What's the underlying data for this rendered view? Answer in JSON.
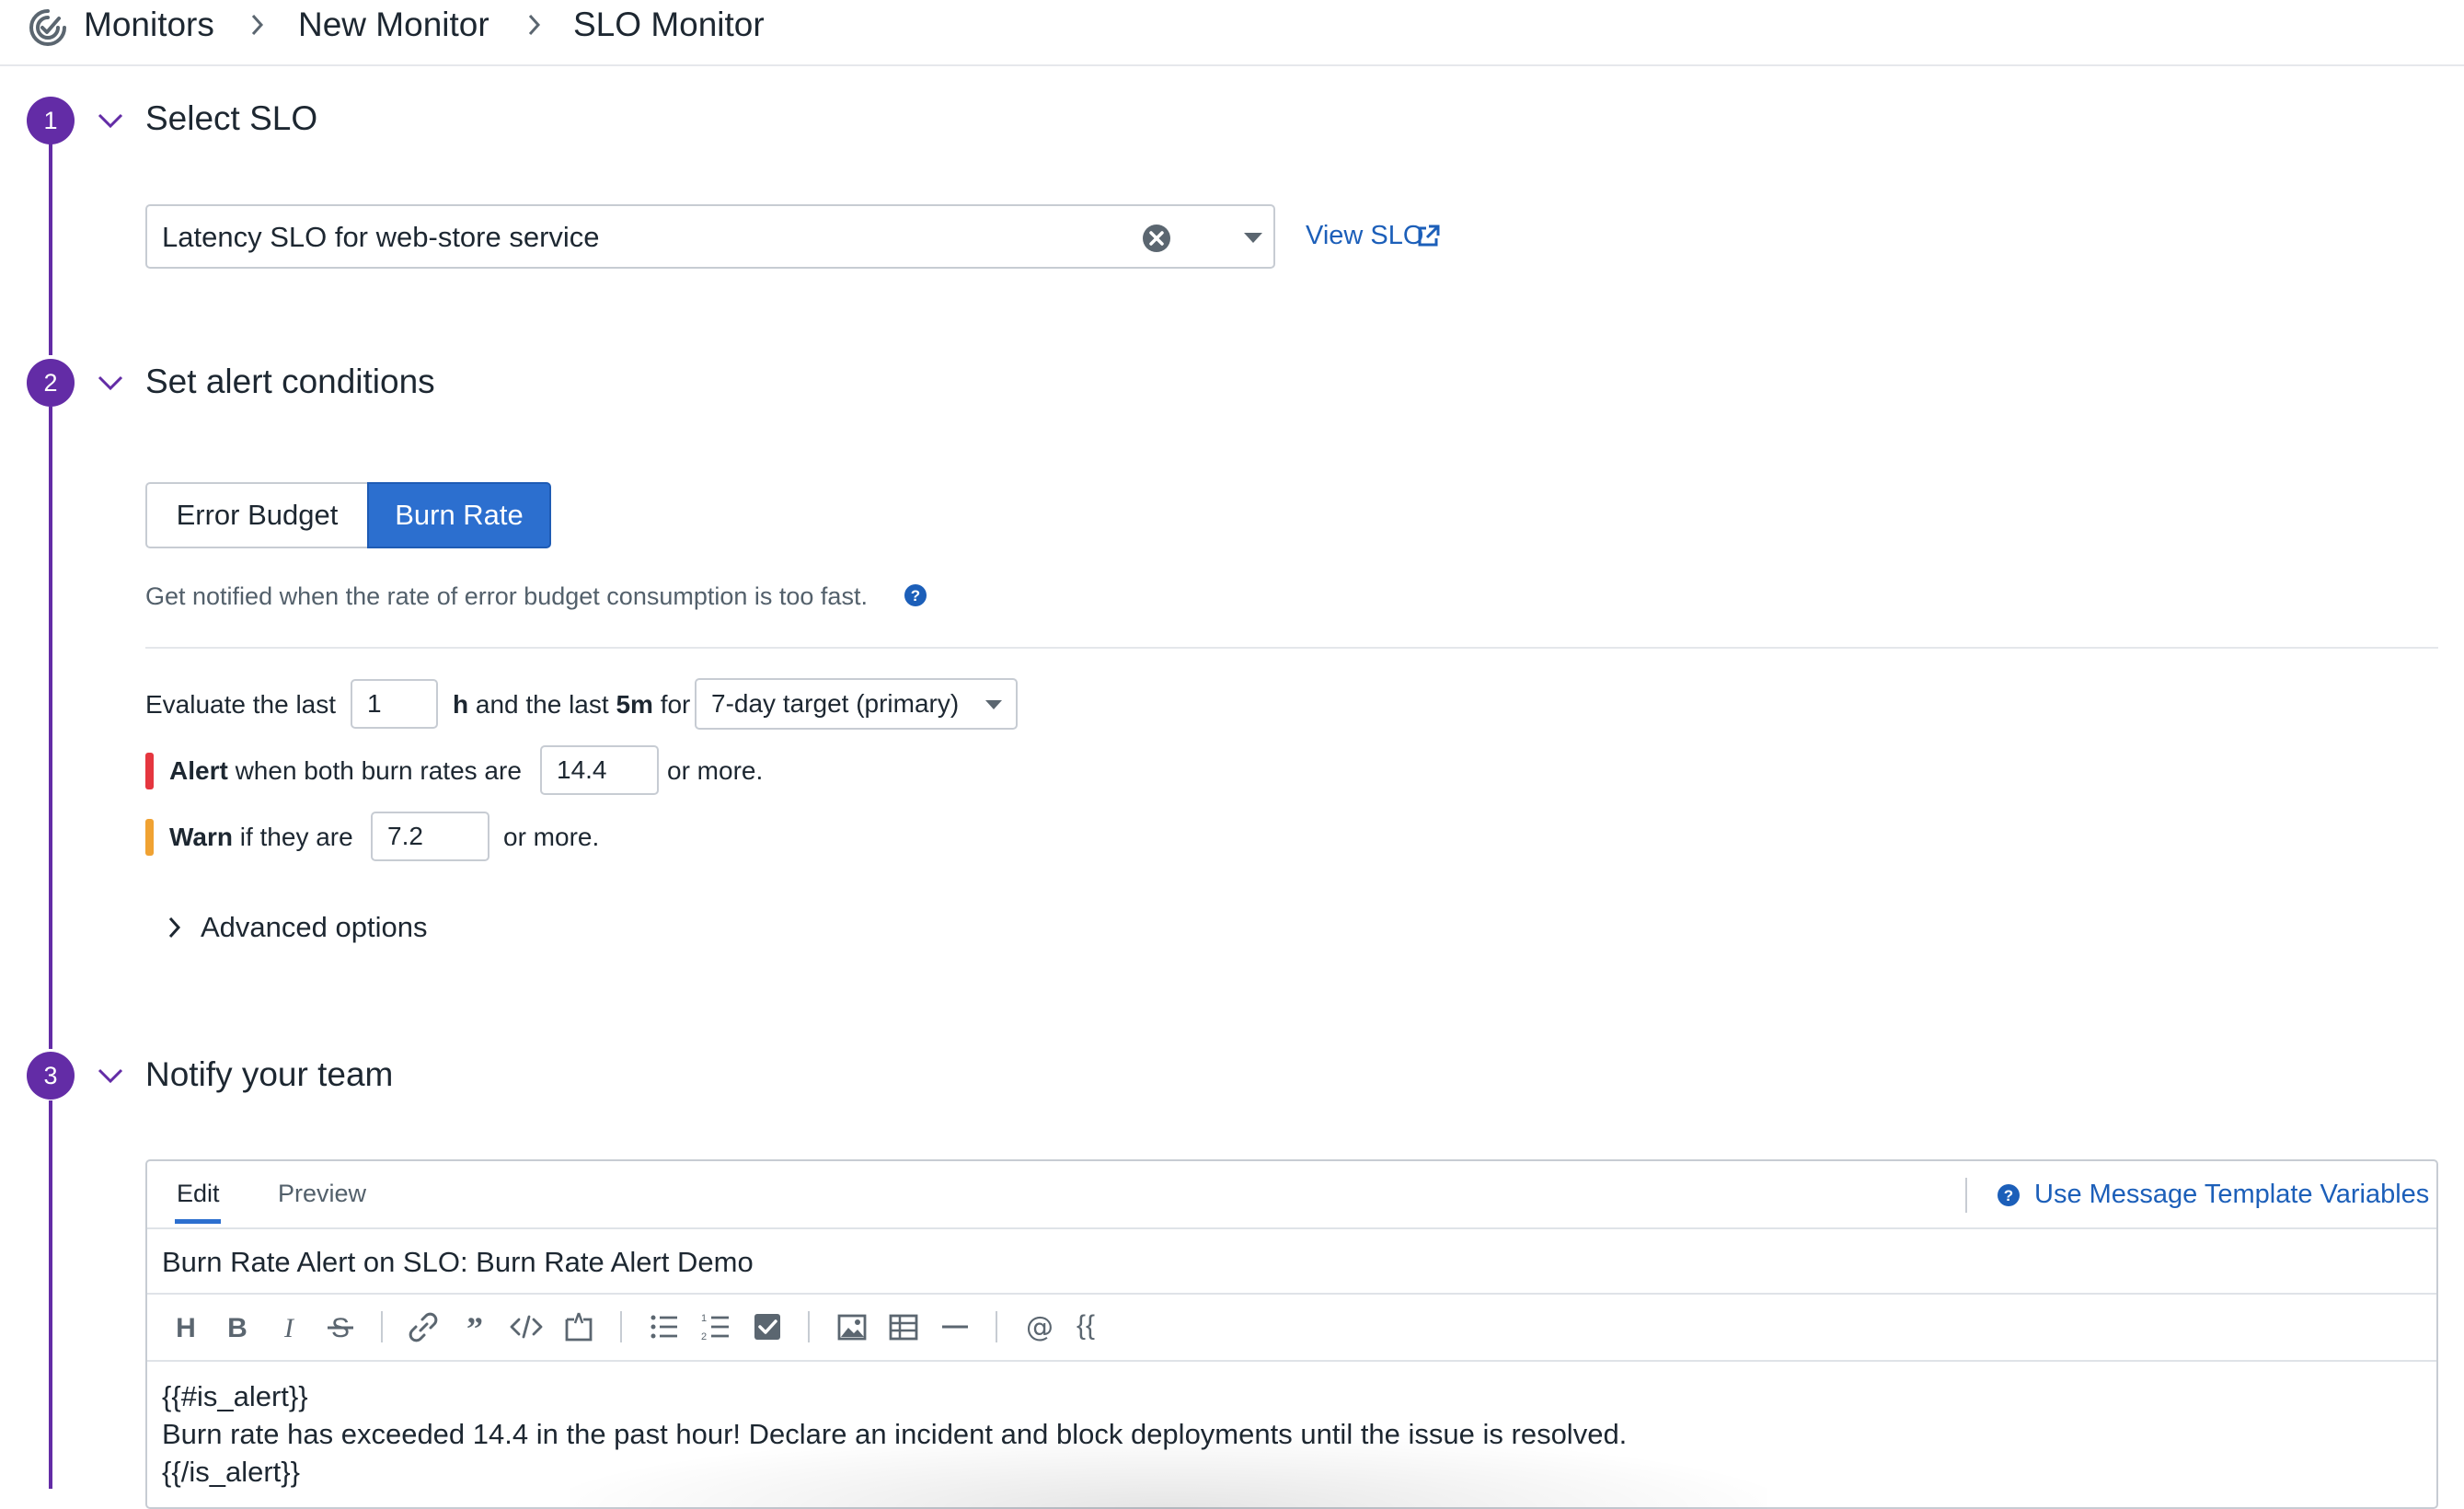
{
  "breadcrumb": {
    "items": [
      "Monitors",
      "New Monitor",
      "SLO Monitor"
    ]
  },
  "steps": {
    "step1": {
      "number": "1",
      "title": "Select SLO"
    },
    "step2": {
      "number": "2",
      "title": "Set alert conditions"
    },
    "step3": {
      "number": "3",
      "title": "Notify your team"
    }
  },
  "slo": {
    "selected": "Latency SLO for web-store service",
    "view_link": "View SLO"
  },
  "conditions": {
    "tabs": [
      "Error Budget",
      "Burn Rate"
    ],
    "active_tab": "Burn Rate",
    "description": "Get notified when the rate of error budget consumption is too fast.",
    "evaluate_label": "Evaluate the last",
    "evaluate_value": "1",
    "h_label": "h",
    "and_the_last_label": "and the last",
    "short_window": "5m",
    "for_label": "for",
    "target_selected": "7-day target (primary)",
    "alert_word": "Alert",
    "alert_label": "when both burn rates are",
    "alert_value": "14.4",
    "or_more": "or more.",
    "warn_word": "Warn",
    "warn_label": "if they are",
    "warn_value": "7.2",
    "advanced_options": "Advanced options"
  },
  "notify": {
    "tabs": [
      "Edit",
      "Preview"
    ],
    "active_tab": "Edit",
    "template_link": "Use Message Template Variables",
    "subject": "Burn Rate Alert on SLO: Burn Rate Alert Demo",
    "body_lines": [
      "{{#is_alert}}",
      "Burn rate has exceeded 14.4 in the past hour! Declare an incident and block deployments until the issue is resolved.",
      "{{/is_alert}}"
    ],
    "toolbar_variable_glyph": "{{"
  },
  "colors": {
    "accent_purple": "#632ca6",
    "primary_blue": "#2c6fcf",
    "link_blue": "#1c5fb9",
    "alert_red": "#e5363f",
    "warn_orange": "#f0a232"
  }
}
